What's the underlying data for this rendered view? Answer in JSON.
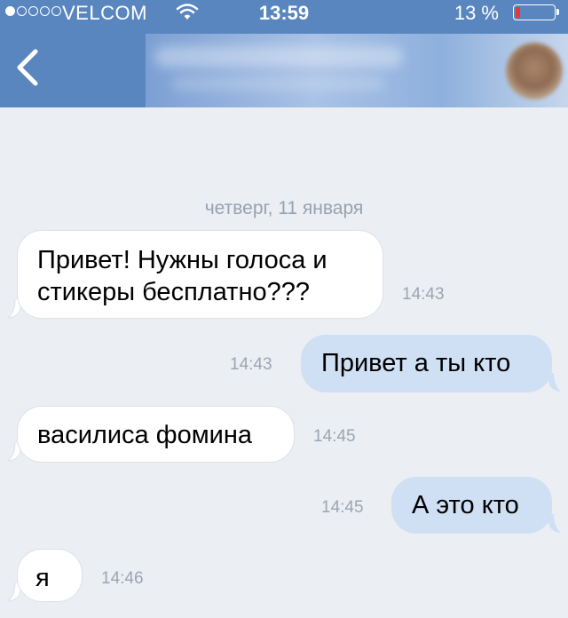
{
  "status_bar": {
    "carrier": "VELCOM",
    "time": "13:59",
    "battery_percent": "13 %",
    "battery_level": 0.13,
    "signal_bars_filled": 1,
    "signal_bars_total": 5,
    "battery_color": "#e53935"
  },
  "header": {
    "back_icon": "chevron-left-icon",
    "contact_name": "",
    "accent_color": "#5a86bf"
  },
  "chat": {
    "date_separator": "четверг, 11 января",
    "messages": [
      {
        "direction": "incoming",
        "text_lines": [
          "Привет! Нужны голоса и",
          "стикеры бесплатно???"
        ],
        "time": "14:43"
      },
      {
        "direction": "outgoing",
        "text": "Привет а ты кто",
        "time": "14:43"
      },
      {
        "direction": "incoming",
        "text": "василиса фомина",
        "time": "14:45"
      },
      {
        "direction": "outgoing",
        "text": "А это кто",
        "time": "14:45"
      },
      {
        "direction": "incoming",
        "text": "я",
        "time": "14:46"
      }
    ]
  }
}
